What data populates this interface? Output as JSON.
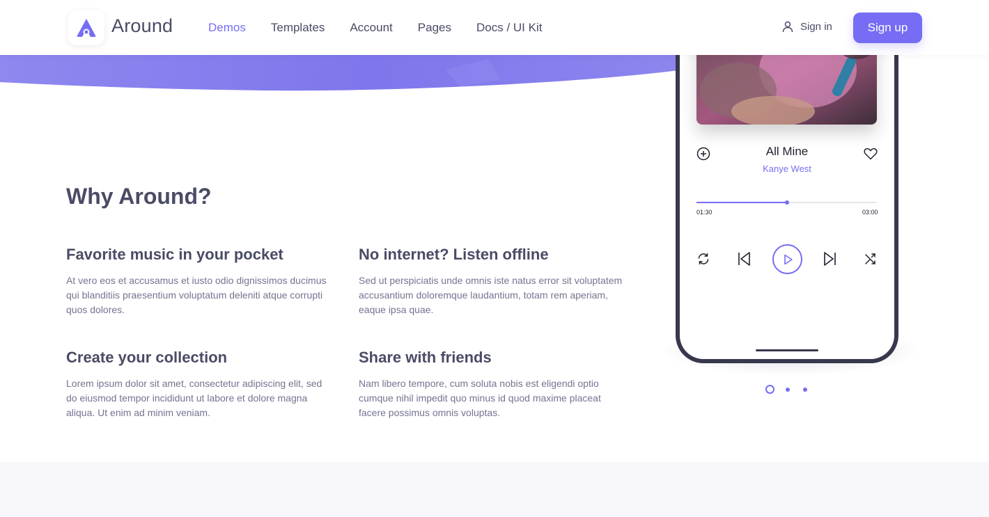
{
  "header": {
    "brand": "Around",
    "nav": [
      {
        "label": "Demos",
        "active": true
      },
      {
        "label": "Templates",
        "active": false
      },
      {
        "label": "Account",
        "active": false
      },
      {
        "label": "Pages",
        "active": false
      },
      {
        "label": "Docs / UI Kit",
        "active": false
      }
    ],
    "signin_label": "Sign in",
    "signup_label": "Sign up"
  },
  "section": {
    "title": "Why Around?",
    "features": [
      {
        "title": "Favorite music in your pocket",
        "text": "At vero eos et accusamus et iusto odio dignissimos ducimus qui blanditiis praesentium voluptatum deleniti atque corrupti quos dolores."
      },
      {
        "title": "No internet? Listen offline",
        "text": "Sed ut perspiciatis unde omnis iste natus error sit voluptatem accusantium doloremque laudantium, totam rem aperiam, eaque ipsa quae."
      },
      {
        "title": "Create your collection",
        "text": "Lorem ipsum dolor sit amet, consectetur adipiscing elit, sed do eiusmod tempor incididunt ut labore et dolore magna aliqua. Ut enim ad minim veniam."
      },
      {
        "title": "Share with friends",
        "text": "Nam libero tempore, cum soluta nobis est eligendi optio cumque nihil impedit quo minus id quod maxime placeat facere possimus omnis voluptas."
      }
    ]
  },
  "player": {
    "song": "All Mine",
    "artist": "Kanye West",
    "elapsed": "01:30",
    "duration": "03:00",
    "progress": 0.5,
    "icons": [
      "add-icon",
      "heart-icon",
      "repeat-icon",
      "previous-icon",
      "play-icon",
      "next-icon",
      "shuffle-icon"
    ]
  },
  "carousel": {
    "slides": 3,
    "active": 0
  },
  "colors": {
    "accent": "#766df4",
    "text": "#4a4b65",
    "muted": "#737491",
    "phone_frame": "#37384e",
    "band": "#f7f7fc"
  }
}
